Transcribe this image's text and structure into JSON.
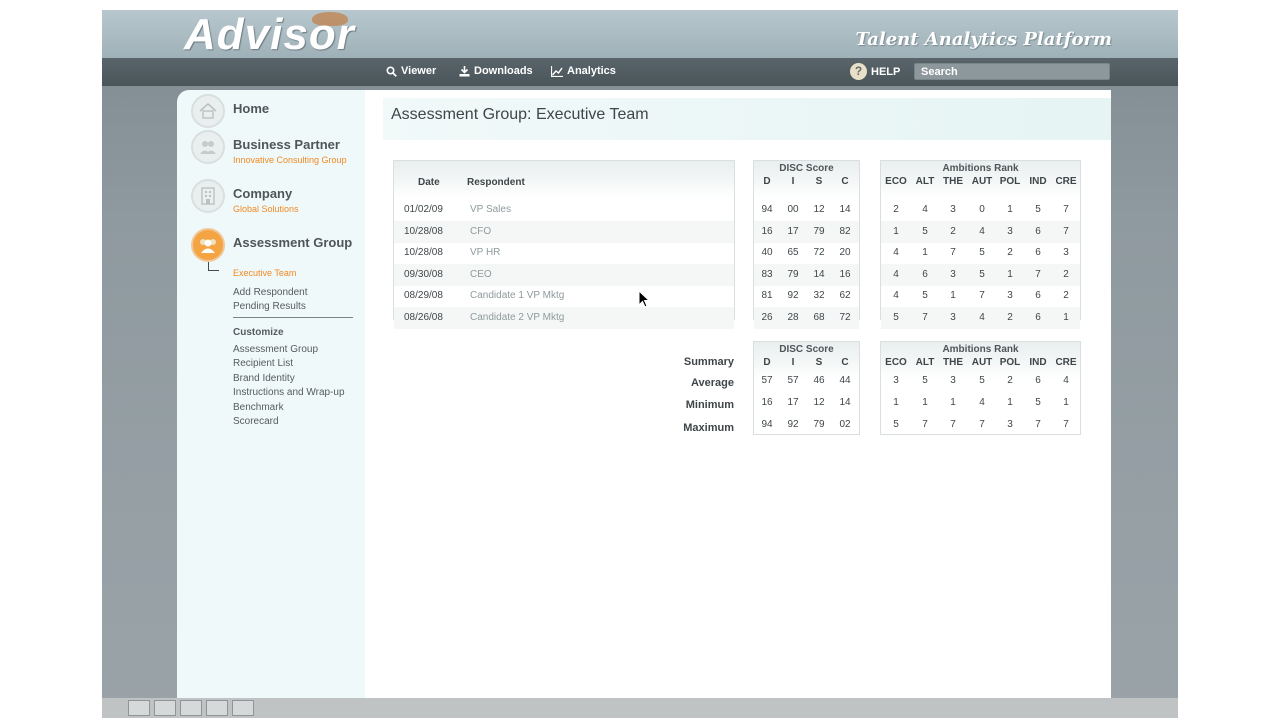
{
  "app": {
    "logo": "Advisor",
    "tagline": "Talent Analytics Platform"
  },
  "nav": {
    "viewer": "Viewer",
    "downloads": "Downloads",
    "analytics": "Analytics",
    "help": "HELP",
    "search_placeholder": "Search"
  },
  "sidebar": {
    "home": "Home",
    "business_partner": "Business Partner",
    "business_partner_sub": "Innovative Consulting Group",
    "company": "Company",
    "company_sub": "Global Solutions",
    "assessment_group": "Assessment Group",
    "assessment_group_sub": "Executive Team",
    "add_respondent": "Add Respondent",
    "pending_results": "Pending Results",
    "customize_header": "Customize",
    "customize_items": [
      "Assessment Group",
      "Recipient List",
      "Brand Identity",
      "Instructions and Wrap-up",
      "Benchmark",
      "Scorecard"
    ]
  },
  "page": {
    "title": "Assessment Group: Executive Team"
  },
  "table": {
    "col_date": "Date",
    "col_respondent": "Respondent",
    "disc_header": "DISC Score",
    "disc_cols": [
      "D",
      "I",
      "S",
      "C"
    ],
    "amb_header": "Ambitions Rank",
    "amb_cols": [
      "ECO",
      "ALT",
      "THE",
      "AUT",
      "POL",
      "IND",
      "CRE"
    ],
    "rows": [
      {
        "date": "01/02/09",
        "respondent": "VP Sales",
        "disc": [
          "94",
          "00",
          "12",
          "14"
        ],
        "amb": [
          "2",
          "4",
          "3",
          "0",
          "1",
          "5",
          "7"
        ]
      },
      {
        "date": "10/28/08",
        "respondent": "CFO",
        "disc": [
          "16",
          "17",
          "79",
          "82"
        ],
        "amb": [
          "1",
          "5",
          "2",
          "4",
          "3",
          "6",
          "7"
        ]
      },
      {
        "date": "10/28/08",
        "respondent": "VP HR",
        "disc": [
          "40",
          "65",
          "72",
          "20"
        ],
        "amb": [
          "4",
          "1",
          "7",
          "5",
          "2",
          "6",
          "3"
        ]
      },
      {
        "date": "09/30/08",
        "respondent": "CEO",
        "disc": [
          "83",
          "79",
          "14",
          "16"
        ],
        "amb": [
          "4",
          "6",
          "3",
          "5",
          "1",
          "7",
          "2"
        ]
      },
      {
        "date": "08/29/08",
        "respondent": "Candidate 1 VP Mktg",
        "disc": [
          "81",
          "92",
          "32",
          "62"
        ],
        "amb": [
          "4",
          "5",
          "1",
          "7",
          "3",
          "6",
          "2"
        ]
      },
      {
        "date": "08/26/08",
        "respondent": "Candidate 2 VP Mktg",
        "disc": [
          "26",
          "28",
          "68",
          "72"
        ],
        "amb": [
          "5",
          "7",
          "3",
          "4",
          "2",
          "6",
          "1"
        ]
      }
    ]
  },
  "summary": {
    "summary_label": "Summary",
    "disc_header": "DISC Score",
    "amb_header": "Ambitions Rank",
    "rows": [
      {
        "label": "Average",
        "disc": [
          "57",
          "57",
          "46",
          "44"
        ],
        "amb": [
          "3",
          "5",
          "3",
          "5",
          "2",
          "6",
          "4"
        ]
      },
      {
        "label": "Minimum",
        "disc": [
          "16",
          "17",
          "12",
          "14"
        ],
        "amb": [
          "1",
          "1",
          "1",
          "4",
          "1",
          "5",
          "1"
        ]
      },
      {
        "label": "Maximum",
        "disc": [
          "94",
          "92",
          "79",
          "02"
        ],
        "amb": [
          "5",
          "7",
          "7",
          "7",
          "3",
          "7",
          "7"
        ]
      }
    ]
  }
}
